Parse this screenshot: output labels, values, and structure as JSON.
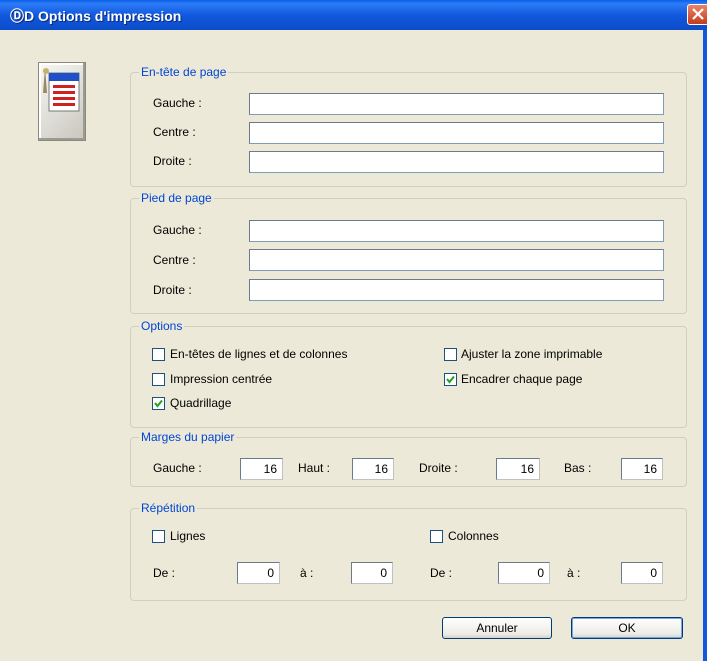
{
  "window": {
    "title": "Options d'impression",
    "icon_name": "4d-logo-icon",
    "close_icon": "close-icon"
  },
  "app_icon": "print-document-icon",
  "header": {
    "title": "En-tête de page",
    "left_label": "Gauche :",
    "left_value": "",
    "center_label": "Centre :",
    "center_value": "",
    "right_label": "Droite :",
    "right_value": ""
  },
  "footer": {
    "title": "Pied de page",
    "left_label": "Gauche :",
    "left_value": "",
    "center_label": "Centre :",
    "center_value": "",
    "right_label": "Droite :",
    "right_value": ""
  },
  "options": {
    "title": "Options",
    "row_col_headers": {
      "label": "En-têtes de lignes et de colonnes",
      "checked": false
    },
    "fit_printable": {
      "label": "Ajuster la zone imprimable",
      "checked": false
    },
    "centered": {
      "label": "Impression centrée",
      "checked": false
    },
    "frame_each_page": {
      "label": "Encadrer chaque page",
      "checked": true
    },
    "grid": {
      "label": "Quadrillage",
      "checked": true
    }
  },
  "margins": {
    "title": "Marges du papier",
    "left_label": "Gauche :",
    "left_value": "16",
    "top_label": "Haut :",
    "top_value": "16",
    "right_label": "Droite :",
    "right_value": "16",
    "bottom_label": "Bas :",
    "bottom_value": "16"
  },
  "repeat": {
    "title": "Répétition",
    "rows": {
      "label": "Lignes",
      "checked": false,
      "from_label": "De :",
      "from_value": "0",
      "to_label": "à :",
      "to_value": "0"
    },
    "cols": {
      "label": "Colonnes",
      "checked": false,
      "from_label": "De :",
      "from_value": "0",
      "to_label": "à :",
      "to_value": "0"
    }
  },
  "buttons": {
    "cancel": "Annuler",
    "ok": "OK"
  },
  "colors": {
    "titlebar": "#1158DE",
    "group_title": "#0046D5",
    "dialog_bg": "#ECE9D8",
    "check": "#21A121"
  }
}
